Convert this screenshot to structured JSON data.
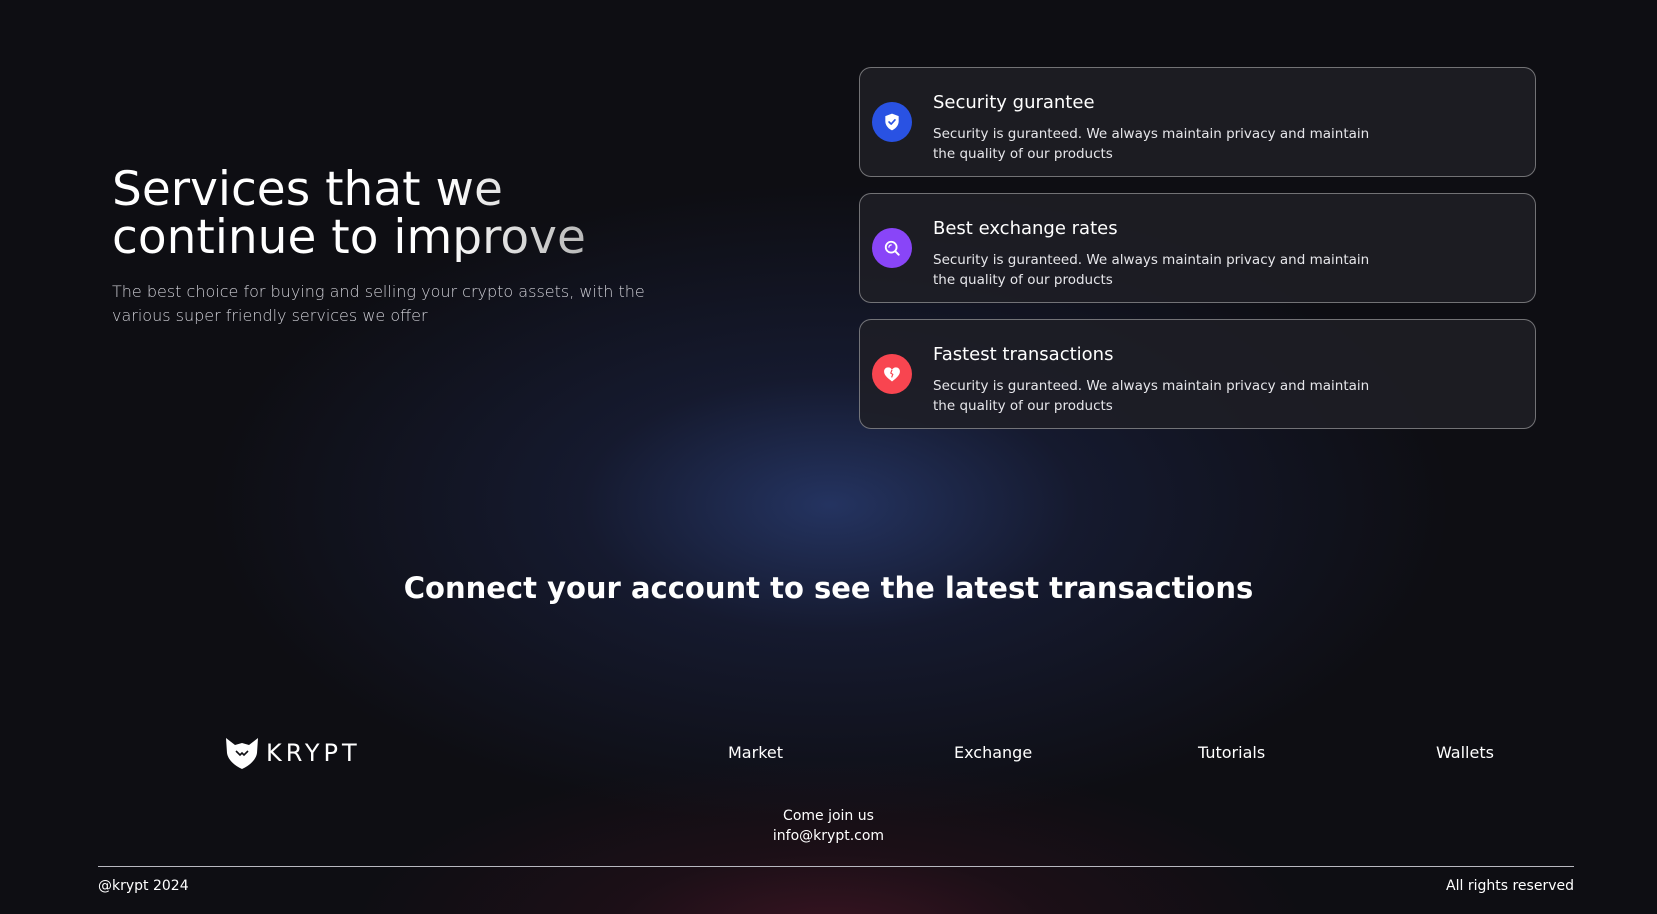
{
  "hero": {
    "title_line1": "Services that we",
    "title_line2": "continue to improve",
    "subtitle": "The best choice for buying and selling your crypto assets, with the various super friendly services we offer"
  },
  "services": [
    {
      "title": "Security gurantee",
      "description": "Security is guranteed. We always maintain privacy and maintain the quality of our products",
      "icon": "shield-check-icon",
      "color": "#2952e3"
    },
    {
      "title": "Best exchange rates",
      "description": "Security is guranteed. We always maintain privacy and maintain the quality of our products",
      "icon": "search-icon",
      "color": "#8945f8"
    },
    {
      "title": "Fastest transactions",
      "description": "Security is guranteed. We always maintain privacy and maintain the quality of our products",
      "icon": "heart-icon",
      "color": "#f84550"
    }
  ],
  "connect_text": "Connect your account to see the latest transactions",
  "footer": {
    "logo_text": "KRYPT",
    "links": [
      "Market",
      "Exchange",
      "Tutorials",
      "Wallets"
    ],
    "join_label": "Come join us",
    "email": "info@krypt.com",
    "copyright": "@krypt 2024",
    "rights": "All rights reserved"
  }
}
